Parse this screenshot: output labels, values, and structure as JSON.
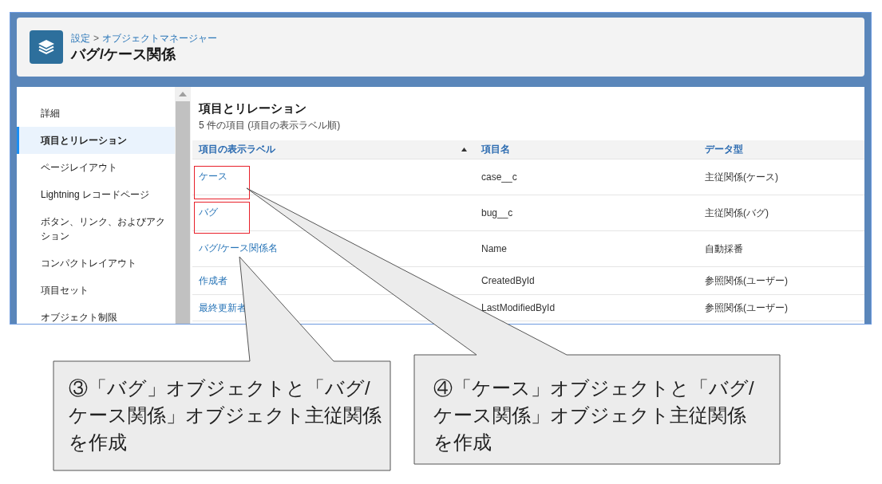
{
  "header": {
    "breadcrumb": [
      {
        "label": "設定"
      },
      {
        "label": "オブジェクトマネージャー"
      }
    ],
    "separator": ">",
    "title": "バグ/ケース関係"
  },
  "sidebar": {
    "items": [
      {
        "label": "詳細",
        "selected": false
      },
      {
        "label": "項目とリレーション",
        "selected": true
      },
      {
        "label": "ページレイアウト",
        "selected": false
      },
      {
        "label": "Lightning レコードページ",
        "selected": false
      },
      {
        "label": "ボタン、リンク、およびアクション",
        "selected": false
      },
      {
        "label": "コンパクトレイアウト",
        "selected": false
      },
      {
        "label": "項目セット",
        "selected": false
      },
      {
        "label": "オブジェクト制限",
        "selected": false
      }
    ]
  },
  "section": {
    "title": "項目とリレーション",
    "subtitle": "5 件の項目 (項目の表示ラベル順)"
  },
  "table": {
    "columns": [
      {
        "label": "項目の表示ラベル",
        "sorted": true
      },
      {
        "label": "項目名",
        "sorted": false
      },
      {
        "label": "データ型",
        "sorted": false
      }
    ],
    "rows": [
      {
        "label": "ケース",
        "name": "case__c",
        "type": "主従関係(ケース)",
        "highlighted": true
      },
      {
        "label": "バグ",
        "name": "bug__c",
        "type": "主従関係(バグ)",
        "highlighted": true
      },
      {
        "label": "バグ/ケース関係名",
        "name": "Name",
        "type": "自動採番",
        "highlighted": false
      },
      {
        "label": "作成者",
        "name": "CreatedById",
        "type": "参照関係(ユーザー)",
        "highlighted": false
      },
      {
        "label": "最終更新者",
        "name": "LastModifiedById",
        "type": "参照関係(ユーザー)",
        "highlighted": false
      }
    ]
  },
  "callouts": [
    {
      "text": "③「バグ」オブジェクトと「バグ/ケース関係」オブジェクト主従関係を作成"
    },
    {
      "text": "④「ケース」オブジェクトと「バグ/ケース関係」オブジェクト主従関係を作成"
    }
  ]
}
